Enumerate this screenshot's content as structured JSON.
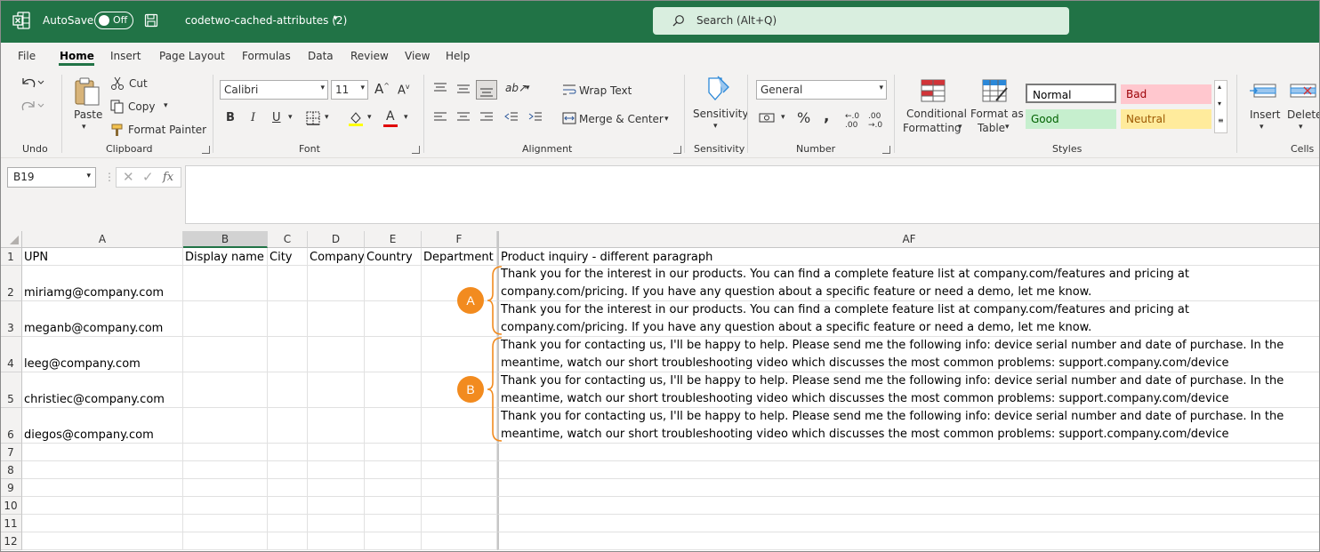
{
  "titlebar": {
    "autosave_label": "AutoSave",
    "toggle_state": "Off",
    "doc_title": "codetwo-cached-attributes (2)",
    "search_placeholder": "Search (Alt+Q)"
  },
  "tabs": [
    "File",
    "Home",
    "Insert",
    "Page Layout",
    "Formulas",
    "Data",
    "Review",
    "View",
    "Help"
  ],
  "ribbon": {
    "undo_group": "Undo",
    "clipboard": {
      "paste": "Paste",
      "cut": "Cut",
      "copy": "Copy",
      "format_painter": "Format Painter",
      "label": "Clipboard"
    },
    "font": {
      "name": "Calibri",
      "size": "11",
      "label": "Font"
    },
    "alignment": {
      "wrap_text": "Wrap Text",
      "merge_center": "Merge & Center",
      "label": "Alignment"
    },
    "sensitivity": {
      "button": "Sensitivity",
      "label": "Sensitivity"
    },
    "number": {
      "format": "General",
      "label": "Number"
    },
    "styles": {
      "conditional_1": "Conditional",
      "conditional_2": "Formatting",
      "format_as_1": "Format as",
      "format_as_2": "Table",
      "normal": "Normal",
      "bad": "Bad",
      "good": "Good",
      "neutral": "Neutral",
      "label": "Styles"
    },
    "cells": {
      "insert": "Insert",
      "delete": "Delete",
      "label": "Cells"
    }
  },
  "formulabar": {
    "namebox": "B19",
    "fx": "fx",
    "value": ""
  },
  "grid": {
    "columns": [
      "A",
      "B",
      "C",
      "D",
      "E",
      "F",
      "AF"
    ],
    "rows": [
      "1",
      "2",
      "3",
      "4",
      "5",
      "6",
      "7",
      "8",
      "9",
      "10",
      "11",
      "12"
    ],
    "headers": [
      "UPN",
      "Display name",
      "City",
      "Company",
      "Country",
      "Department",
      "Product inquiry - different paragraph"
    ],
    "upn": [
      "miriamg@company.com",
      "meganb@company.com",
      "leeg@company.com",
      "christiec@company.com",
      "diegos@company.com"
    ],
    "af": [
      "Thank you for the interest in our products. You can find a complete feature list at company.com/features and pricing at company.com/pricing. If you have any question about a specific feature or need a demo, let me know.",
      "Thank you for the interest in our products. You can find a complete feature list at company.com/features and pricing at company.com/pricing. If you have any question about a specific feature or need a demo, let me know.",
      "Thank you for contacting us, I'll be happy to help. Please send me the following info: device serial number and date of purchase. In the meantime, watch our short troubleshooting video which discusses the most common problems: support.company.com/device",
      "Thank you for contacting us, I'll be happy to help. Please send me the following info: device serial number and date of purchase. In the meantime, watch our short troubleshooting video which discusses the most common problems: support.company.com/device",
      "Thank you for contacting us, I'll be happy to help. Please send me the following info: device serial number and date of purchase. In the meantime, watch our short troubleshooting video which discusses the most common problems: support.company.com/device"
    ]
  },
  "annotations": {
    "a": "A",
    "b": "B"
  },
  "colors": {
    "excel_green": "#217346",
    "annotation_orange": "#f28b1f"
  }
}
